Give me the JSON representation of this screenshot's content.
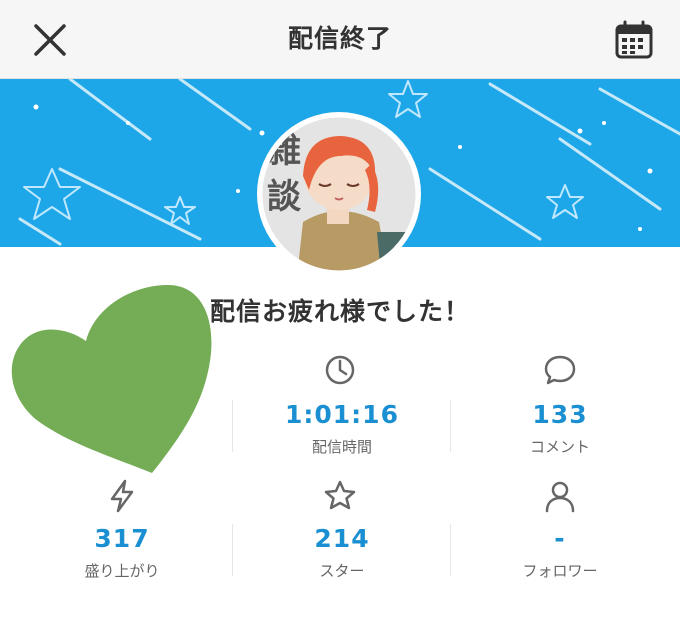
{
  "header": {
    "title": "配信終了"
  },
  "message": "配信お疲れ様でした！",
  "avatar": {
    "badge_text": "雑談"
  },
  "stats": [
    {
      "icon": "clock-icon",
      "value": "1:01:16",
      "label": "配信時間"
    },
    {
      "icon": "comment-icon",
      "value": "133",
      "label": "コメント"
    },
    {
      "icon": "lightning-icon",
      "value": "317",
      "label": "盛り上がり"
    },
    {
      "icon": "star-icon",
      "value": "214",
      "label": "スター"
    },
    {
      "icon": "person-icon",
      "value": "-",
      "label": "フォロワー"
    }
  ],
  "colors": {
    "accent": "#1a8fd1",
    "banner": "#1ea7e8",
    "heart": "#74ad56"
  }
}
